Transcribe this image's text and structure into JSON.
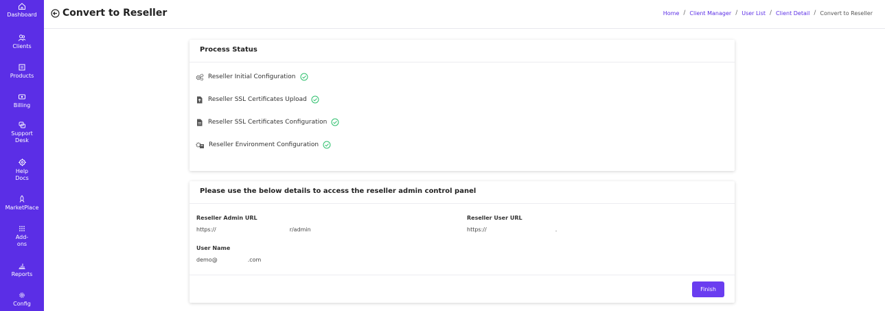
{
  "sidebar": {
    "items": [
      {
        "label": "Dashboard",
        "icon": "home-icon"
      },
      {
        "label": "Clients",
        "icon": "users-icon"
      },
      {
        "label": "Products",
        "icon": "products-icon"
      },
      {
        "label": "Billing",
        "icon": "billing-icon"
      },
      {
        "label": "Support\nDesk",
        "icon": "support-icon"
      },
      {
        "label": "Help\nDocs",
        "icon": "help-icon"
      },
      {
        "label": "MarketPlace",
        "icon": "rocket-icon"
      },
      {
        "label": "Add-\nons",
        "icon": "grid-icon"
      },
      {
        "label": "Reports",
        "icon": "chart-icon"
      },
      {
        "label": "Config",
        "icon": "gear-icon"
      }
    ]
  },
  "header": {
    "title": "Convert to Reseller",
    "breadcrumb": [
      "Home",
      "Client Manager",
      "User List",
      "Client Detail",
      "Convert to Reseller"
    ]
  },
  "process": {
    "title": "Process Status",
    "steps": [
      {
        "label": "Reseller Initial Configuration",
        "icon": "cogs-icon",
        "status": "complete"
      },
      {
        "label": "Reseller SSL Certificates Upload",
        "icon": "file-upload-icon",
        "status": "complete"
      },
      {
        "label": "Reseller SSL Certificates Configuration",
        "icon": "file-icon",
        "status": "complete"
      },
      {
        "label": "Reseller Environment Configuration",
        "icon": "environment-icon",
        "status": "complete"
      }
    ]
  },
  "access": {
    "title": "Please use the below details to access the reseller admin control panel",
    "admin_url_label": "Reseller Admin URL",
    "admin_url_prefix": "https://",
    "admin_url_suffix": "r/admin",
    "user_url_label": "Reseller User URL",
    "user_url_prefix": "https://",
    "user_url_suffix": ".",
    "username_label": "User Name",
    "username_prefix": "demo@",
    "username_suffix": ".com",
    "finish_label": "Finish"
  },
  "colors": {
    "accent": "#5b2ee6",
    "success": "#2dbf6c"
  }
}
